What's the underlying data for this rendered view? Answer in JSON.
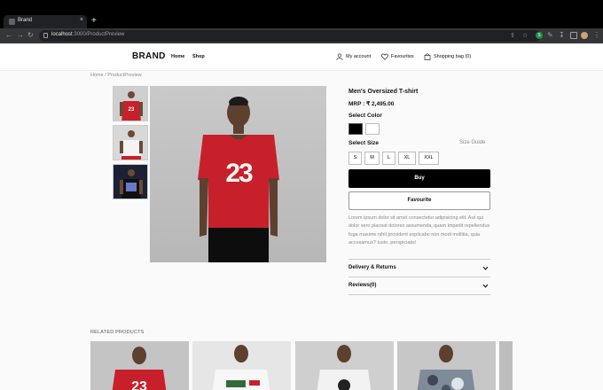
{
  "browser": {
    "tab_title": "Brand",
    "tab_close": "×",
    "new_tab": "+",
    "url_host": "localhost",
    "url_path": ":3000/ProductPreview",
    "ext_badge": "S"
  },
  "header": {
    "brand": "BRAND",
    "nav": [
      "Home",
      "Shop"
    ],
    "account": "My account",
    "favourites": "Favourites",
    "bag": "Shopping bag (0)"
  },
  "breadcrumb": "Home / ProductPreview",
  "product": {
    "title": "Men's Oversized T-shirt",
    "price": "MRP : ₹ 2,495.00",
    "select_color_label": "Select Color",
    "colors": [
      "#000000",
      "#ffffff"
    ],
    "select_size_label": "Select Size",
    "size_guide": "Size Guide",
    "sizes": [
      "S",
      "M",
      "L",
      "XL",
      "XXL"
    ],
    "buy_label": "Buy",
    "favourite_label": "Favourite",
    "description": "Lorem ipsum dolor sit amet consectetur adipisicing elit. Aut qui dolor vero placeat dolores assumenda, quam impedit repellendus fuga maxime nihil provident explicabo non modi mollitia, quia accusamus? Iusto, perspiciatis!",
    "accordions": [
      "Delivery & Returns",
      "Reviews(0)"
    ]
  },
  "related": {
    "title": "RELATED PRODUCTS"
  },
  "colors": {
    "shirt_red": "#c8202a",
    "buy_bg": "#000000"
  }
}
